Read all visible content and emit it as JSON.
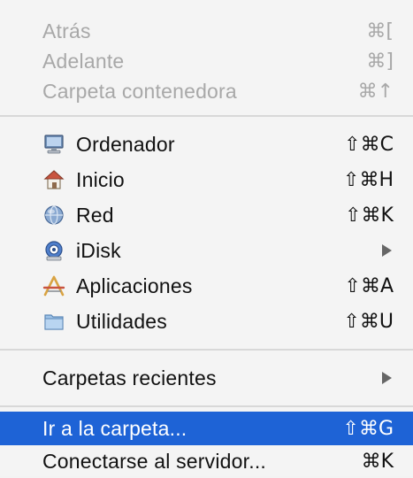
{
  "menu": {
    "nav_items": [
      {
        "label": "Atrás",
        "shortcut": "⌘["
      },
      {
        "label": "Adelante",
        "shortcut": "⌘]"
      },
      {
        "label": "Carpeta contenedora",
        "shortcut": "⌘↑"
      }
    ],
    "location_items": [
      {
        "label": "Ordenador",
        "shortcut": "⇧⌘C",
        "icon": "computer-icon"
      },
      {
        "label": "Inicio",
        "shortcut": "⇧⌘H",
        "icon": "home-icon"
      },
      {
        "label": "Red",
        "shortcut": "⇧⌘K",
        "icon": "network-icon"
      },
      {
        "label": "iDisk",
        "shortcut": "",
        "icon": "idisk-icon"
      },
      {
        "label": "Aplicaciones",
        "shortcut": "⇧⌘A",
        "icon": "applications-icon"
      },
      {
        "label": "Utilidades",
        "shortcut": "⇧⌘U",
        "icon": "utilities-folder-icon"
      }
    ],
    "recent": {
      "label": "Carpetas recientes"
    },
    "actions": [
      {
        "label": "Ir a la carpeta...",
        "shortcut": "⇧⌘G"
      },
      {
        "label": "Conectarse al servidor...",
        "shortcut": "⌘K"
      }
    ],
    "colors": {
      "selection": "#1e63d6",
      "disabled_text": "#a8a8a8"
    }
  }
}
